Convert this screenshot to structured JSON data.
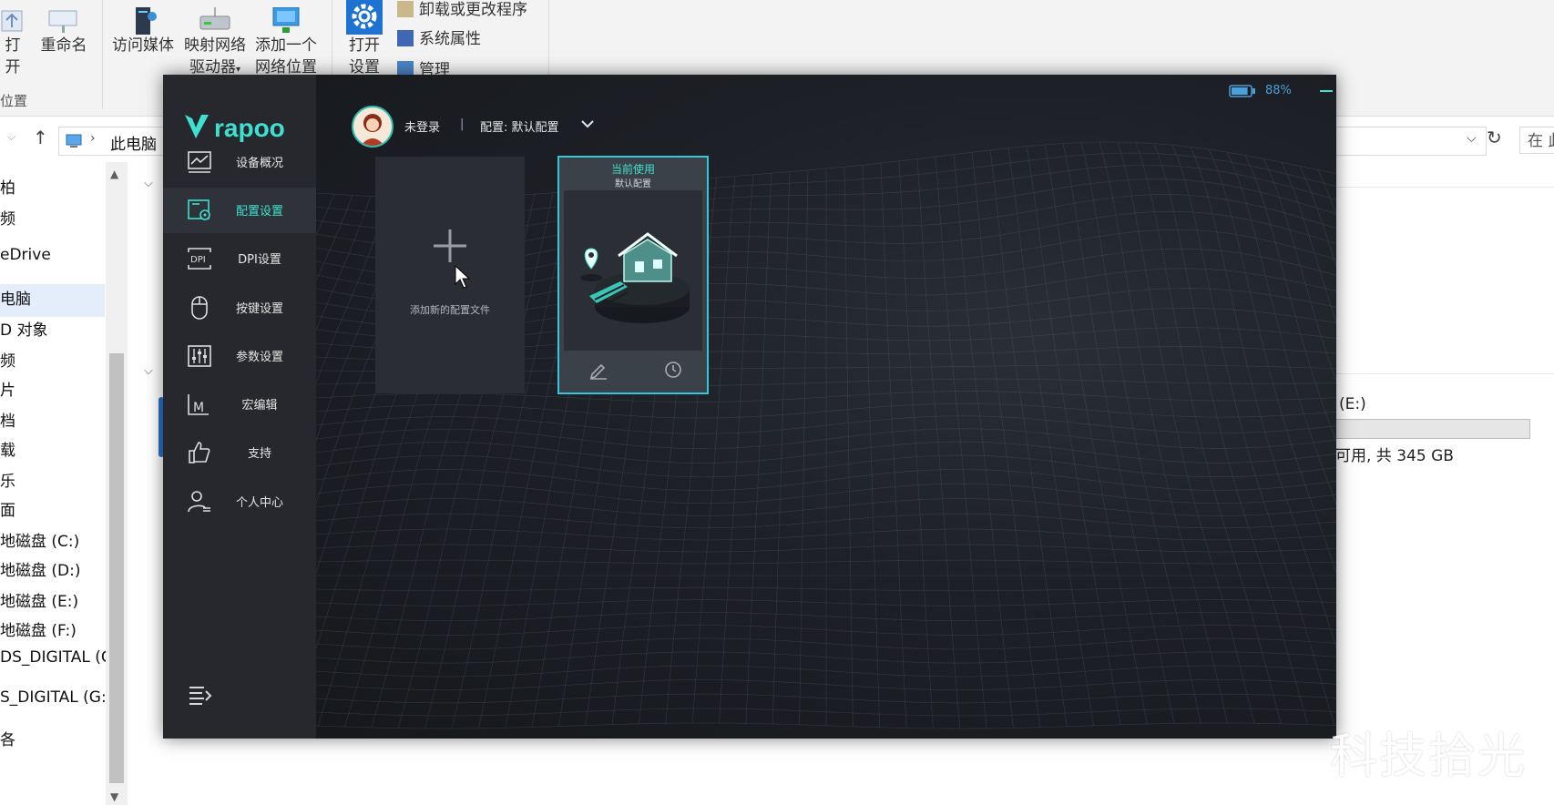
{
  "explorer": {
    "ribbon": {
      "open_label": "打开",
      "rename_label": "重命名",
      "access_media_label": "访问媒体",
      "map_drive_label_1": "映射网络",
      "map_drive_label_2": "驱动器",
      "add_location_label_1": "添加一个",
      "add_location_label_2": "网络位置",
      "settings_label_1": "打开",
      "settings_label_2": "设置",
      "uninstall_label": "卸载或更改程序",
      "system_props_label": "系统属性",
      "manage_label": "管理",
      "location_group_label": "位置"
    },
    "address": {
      "path": "此电脑",
      "search_placeholder": "在 此"
    },
    "nav_items": [
      "柏",
      "频",
      "eDrive",
      "电脑",
      "D 对象",
      "频",
      "片",
      "档",
      "载",
      "乐",
      "面",
      "地磁盘 (C:)",
      "地磁盘 (D:)",
      "地磁盘 (E:)",
      "地磁盘 (F:)",
      "DS_DIGITAL (G",
      "S_DIGITAL (G:)",
      "各"
    ],
    "drive_e": {
      "name": "(E:)",
      "free": "可用, 共 345 GB",
      "usage_fraction": 0.02
    }
  },
  "rapoo": {
    "battery_percent": "88%",
    "battery_level": 0.88,
    "logo_text": "rapoo",
    "menu": [
      {
        "label": "设备概况",
        "icon": "monitor-chart-icon"
      },
      {
        "label": "配置设置",
        "icon": "config-gear-icon"
      },
      {
        "label": "DPI设置",
        "icon": "dpi-icon"
      },
      {
        "label": "按键设置",
        "icon": "mouse-icon"
      },
      {
        "label": "参数设置",
        "icon": "sliders-icon"
      },
      {
        "label": "宏编辑",
        "icon": "macro-m-icon"
      },
      {
        "label": "支持",
        "icon": "thumbs-up-icon"
      },
      {
        "label": "个人中心",
        "icon": "user-list-icon"
      }
    ],
    "active_menu": "配置设置",
    "user": {
      "status": "未登录",
      "separator": "|",
      "config": "配置: 默认配置"
    },
    "add_card_label": "添加新的配置文件",
    "current_card": {
      "header": "当前使用",
      "name": "默认配置"
    },
    "accent_color": "#3ee0cf",
    "card_border_color": "#36c6d9"
  },
  "watermark": "科技拾光"
}
